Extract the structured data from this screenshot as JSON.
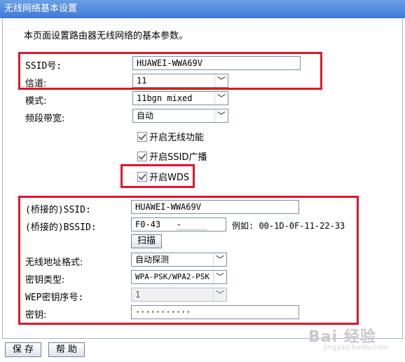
{
  "window": {
    "title": "无线网络基本设置"
  },
  "description": "本页面设置路由器无线网络的基本参数。",
  "basic": {
    "ssid_label": "SSID号:",
    "ssid_value": "HUAWEI-WWA69V",
    "channel_label": "信道:",
    "channel_value": "11",
    "mode_label": "模式:",
    "mode_value": "11bgn mixed",
    "bandwidth_label": "频段带宽:",
    "bandwidth_value": "自动"
  },
  "options": {
    "enable_wireless": "开启无线功能",
    "enable_ssid_broadcast": "开启SSID广播",
    "enable_wds": "开启WDS"
  },
  "wds": {
    "bridge_ssid_label": "(桥接的)SSID:",
    "bridge_ssid_value": "HUAWEI-WWA69V",
    "bridge_bssid_label": "(桥接的)BSSID:",
    "bridge_bssid_value": "F0-43",
    "bridge_bssid_suffix": "-",
    "bssid_example": "例如: 00-1D-0F-11-22-33",
    "scan_button": "扫描",
    "address_format_label": "无线地址格式:",
    "address_format_value": "自动探测",
    "key_type_label": "密钥类型:",
    "key_type_value": "WPA-PSK/WPA2-PSK",
    "wep_index_label": "WEP密钥序号:",
    "wep_index_value": "1",
    "key_label": "密钥:",
    "key_value": "···········"
  },
  "footer": {
    "save_button": "保 存",
    "help_button": "帮 助"
  },
  "watermark": {
    "brand": "Bai 经验",
    "url": "jingyan.baidu.com"
  },
  "colors": {
    "titlebar": "#4a84dc",
    "highlight": "#e0162b"
  }
}
